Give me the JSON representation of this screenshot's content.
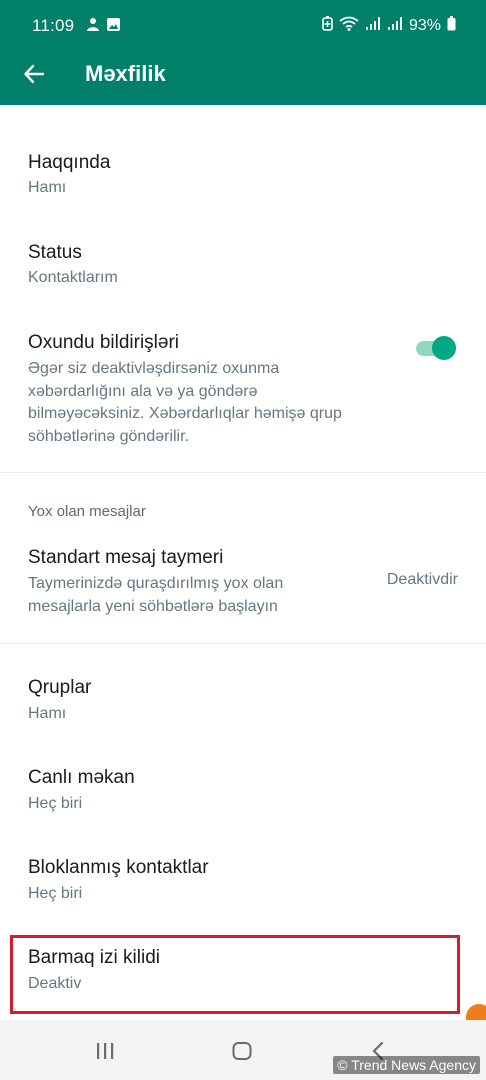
{
  "status_bar": {
    "time": "11:09",
    "battery": "93%",
    "left_icons": [
      "lock-person-icon",
      "image-icon"
    ],
    "right_icons": [
      "battery-saver-icon",
      "wifi-icon",
      "signal-icon",
      "signal-icon",
      "battery-icon"
    ]
  },
  "app_bar": {
    "title": "Məxfilik",
    "back_icon": "arrow-left-icon"
  },
  "settings": {
    "haqqinda": {
      "title": "Haqqında",
      "value": "Hamı"
    },
    "status": {
      "title": "Status",
      "value": "Kontaktlarım"
    },
    "read_receipts": {
      "title": "Oxundu bildirişləri",
      "description_lines": [
        "Əgər siz deaktivləşdirsəniz oxunma",
        "xəbərdarlığını ala və ya göndərə",
        "bilməyəcəksiniz. Xəbərdarlıqlar həmişə qrup",
        "söhbətlərinə göndərilir."
      ],
      "enabled": true
    },
    "disappearing_section": {
      "header": "Yox olan mesajlar",
      "timer_title": "Standart mesaj taymeri",
      "timer_description_lines": [
        "Taymerinizdə quraşdırılmış yox olan",
        "mesajlarla yeni söhbətlərə başlayın"
      ],
      "timer_value": "Deaktivdir"
    },
    "groups": {
      "title": "Qruplar",
      "value": "Hamı"
    },
    "live_location": {
      "title": "Canlı məkan",
      "value": "Heç biri"
    },
    "blocked": {
      "title": "Bloklanmış kontaktlar",
      "value": "Heç biri"
    },
    "fingerprint": {
      "title": "Barmaq izi kilidi",
      "value": "Deaktiv"
    }
  },
  "nav_bar": {
    "recents_icon": "recents-icon",
    "home_icon": "home-icon",
    "back_icon": "back-chevron-icon"
  },
  "watermark": "© Trend News Agency",
  "colors": {
    "header": "#008069",
    "accent": "#00a884",
    "highlight": "#d11f2d"
  }
}
